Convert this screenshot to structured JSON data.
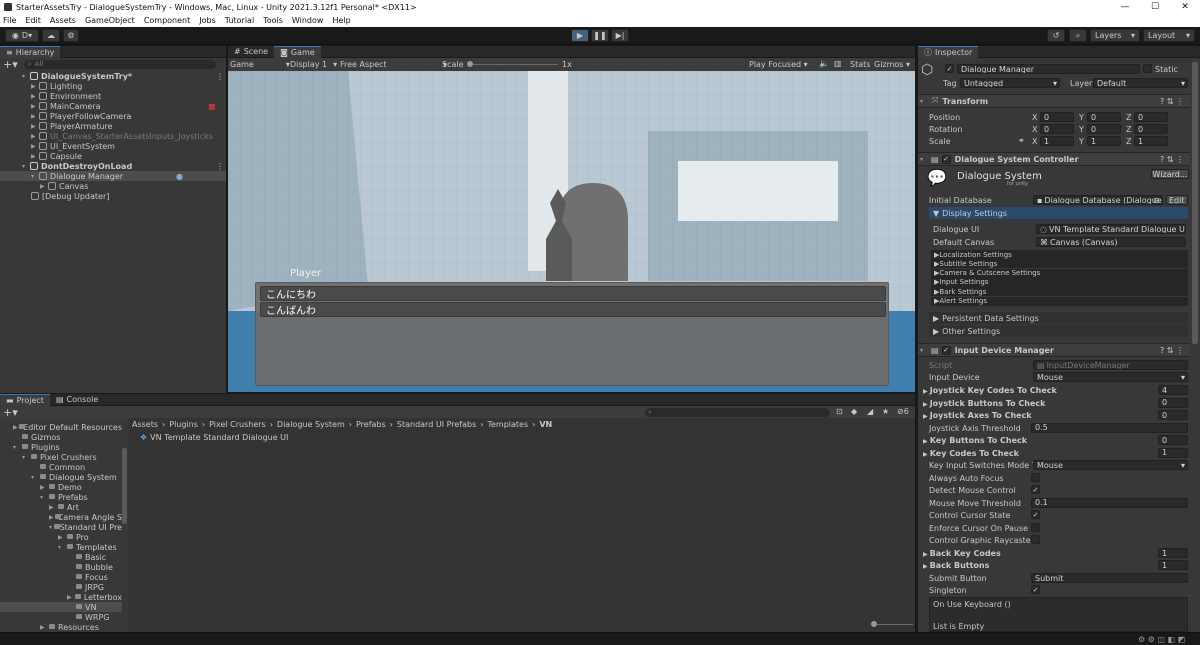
{
  "window": {
    "title": "StarterAssetsTry - DialogueSystemTry - Windows, Mac, Linux - Unity 2021.3.12f1 Personal* <DX11>"
  },
  "menu": [
    "File",
    "Edit",
    "Assets",
    "GameObject",
    "Component",
    "Jobs",
    "Tutorial",
    "Tools",
    "Window",
    "Help"
  ],
  "toolbar": {
    "account": "D",
    "layers": "Layers",
    "layout": "Layout"
  },
  "hierarchy": {
    "tab": "Hierarchy",
    "search_placeholder": "All",
    "scene1": "DialogueSystemTry*",
    "items1": [
      "Lighting",
      "Environment",
      "MainCamera",
      "PlayerFollowCamera",
      "PlayerArmature",
      "UI_Canvas_StarterAssetsInputs_Joysticks",
      "UI_EventSystem",
      "Capsule"
    ],
    "scene2": "DontDestroyOnLoad",
    "items2": [
      "Dialogue Manager",
      "Canvas",
      "[Debug Updater]"
    ]
  },
  "viewtabs": {
    "scene": "Scene",
    "game": "Game"
  },
  "gamebar": {
    "mode": "Game",
    "display": "Display 1",
    "aspect": "Free Aspect",
    "scale_label": "Scale",
    "scale_value": "1x",
    "play_focused": "Play Focused",
    "stats": "Stats",
    "gizmos": "Gizmos"
  },
  "game": {
    "speaker": "Player",
    "choices": [
      "こんにちわ",
      "こんばんわ"
    ]
  },
  "project": {
    "tab": "Project",
    "console_tab": "Console",
    "tree": [
      {
        "t": "Editor Default Resources",
        "d": 1
      },
      {
        "t": "Gizmos",
        "d": 1
      },
      {
        "t": "Plugins",
        "d": 1
      },
      {
        "t": "Pixel Crushers",
        "d": 2
      },
      {
        "t": "Common",
        "d": 3
      },
      {
        "t": "Dialogue System",
        "d": 3
      },
      {
        "t": "Demo",
        "d": 4
      },
      {
        "t": "Prefabs",
        "d": 4
      },
      {
        "t": "Art",
        "d": 5
      },
      {
        "t": "Camera Angle S",
        "d": 5
      },
      {
        "t": "Standard UI Pre",
        "d": 5
      },
      {
        "t": "Pro",
        "d": 6
      },
      {
        "t": "Templates",
        "d": 6
      },
      {
        "t": "Basic",
        "d": 7
      },
      {
        "t": "Bubble",
        "d": 7
      },
      {
        "t": "Focus",
        "d": 7
      },
      {
        "t": "JRPG",
        "d": 7
      },
      {
        "t": "Letterbox",
        "d": 7
      },
      {
        "t": "VN",
        "d": 7
      },
      {
        "t": "WRPG",
        "d": 7
      },
      {
        "t": "Resources",
        "d": 4
      }
    ],
    "breadcrumb": [
      "Assets",
      "Plugins",
      "Pixel Crushers",
      "Dialogue System",
      "Prefabs",
      "Standard UI Prefabs",
      "Templates",
      "VN"
    ],
    "asset": "VN Template Standard Dialogue UI",
    "count": "6"
  },
  "inspector": {
    "tab": "Inspector",
    "object_name": "Dialogue Manager",
    "static": "Static",
    "tag_label": "Tag",
    "tag": "Untagged",
    "layer_label": "Layer",
    "layer": "Default",
    "transform": {
      "title": "Transform",
      "position": "Position",
      "rotation": "Rotation",
      "scale": "Scale",
      "pos": [
        "0",
        "0",
        "0"
      ],
      "rot": [
        "0",
        "0",
        "0"
      ],
      "scl": [
        "1",
        "1",
        "1"
      ],
      "x": "X",
      "y": "Y",
      "z": "Z"
    },
    "dsc": {
      "title": "Dialogue System Controller",
      "logo": "Dialogue System",
      "logo_sub": "for unity",
      "wizard": "Wizard...",
      "initial_db_label": "Initial Database",
      "initial_db": "Dialogue Database (Dialogue Da",
      "edit": "Edit",
      "display_settings": "Display Settings",
      "dialogue_ui_label": "Dialogue UI",
      "dialogue_ui": "VN Template Standard Dialogue UI",
      "default_canvas_label": "Default Canvas",
      "default_canvas": "Canvas (Canvas)",
      "subs": [
        "Localization Settings",
        "Subtitle Settings",
        "Camera & Cutscene Settings",
        "Input Settings",
        "Bark Settings",
        "Alert Settings"
      ],
      "persistent": "Persistent Data Settings",
      "other": "Other Settings"
    },
    "idm": {
      "title": "Input Device Manager",
      "script_label": "Script",
      "script": "InputDeviceManager",
      "input_device_label": "Input Device",
      "input_device": "Mouse",
      "rows": [
        {
          "l": "Joystick Key Codes To Check",
          "v": "4",
          "b": true
        },
        {
          "l": "Joystick Buttons To Check",
          "v": "0",
          "b": true
        },
        {
          "l": "Joystick Axes To Check",
          "v": "0",
          "b": true
        },
        {
          "l": "Joystick Axis Threshold",
          "v": "0.5",
          "b": false
        },
        {
          "l": "Key Buttons To Check",
          "v": "0",
          "b": true
        },
        {
          "l": "Key Codes To Check",
          "v": "1",
          "b": true
        }
      ],
      "switch_label": "Key Input Switches Mode To",
      "switch": "Mouse",
      "checks": [
        {
          "l": "Always Auto Focus",
          "c": ""
        },
        {
          "l": "Detect Mouse Control",
          "c": "✓"
        },
        {
          "l": "Mouse Move Threshold",
          "v": "0.1"
        },
        {
          "l": "Control Cursor State",
          "c": "✓"
        },
        {
          "l": "Enforce Cursor On Pause",
          "c": ""
        },
        {
          "l": "Control Graphic Raycasters",
          "c": ""
        }
      ],
      "back_keys": "Back Key Codes",
      "back_keys_v": "1",
      "back_buttons": "Back Buttons",
      "back_buttons_v": "1",
      "submit_label": "Submit Button",
      "submit": "Submit",
      "singleton": "Singleton",
      "singleton_c": "✓",
      "event": "On Use Keyboard ()",
      "list_empty": "List is Empty"
    }
  }
}
